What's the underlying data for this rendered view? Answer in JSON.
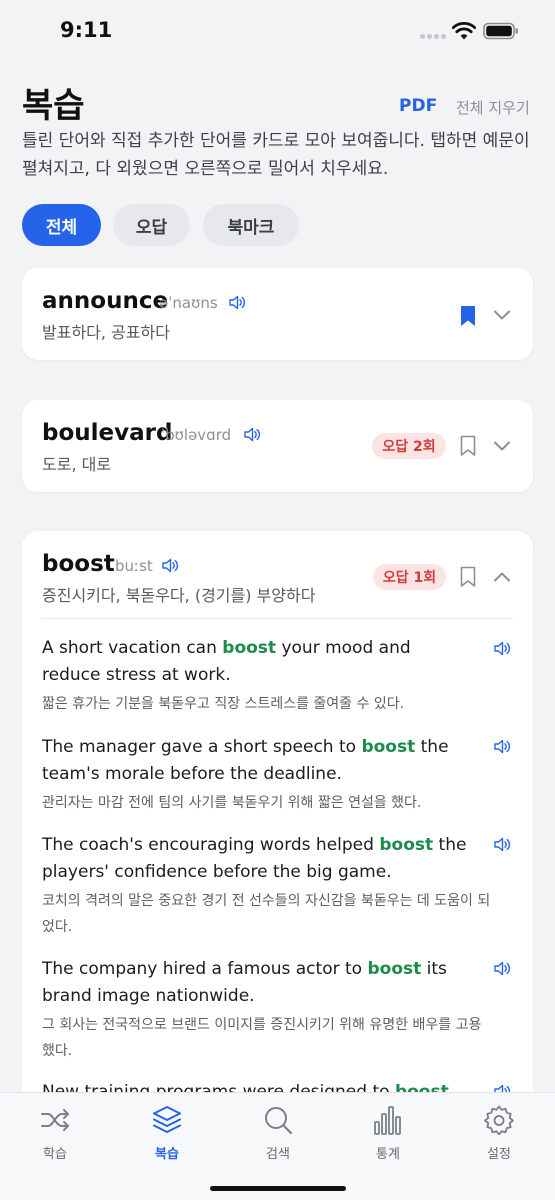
{
  "status_bar": {
    "time": "9:11"
  },
  "header": {
    "title": "복습",
    "pdf_label": "PDF",
    "clear_label": "전체 지우기",
    "description": "틀린 단어와 직접 추가한 단어를 카드로 모아 보여줍니다. 탭하면 예문이 펼쳐지고, 다 외웠으면 오른쪽으로 밀어서 치우세요."
  },
  "filters": [
    {
      "label": "전체",
      "active": true
    },
    {
      "label": "오답",
      "active": false
    },
    {
      "label": "북마크",
      "active": false
    }
  ],
  "cards": [
    {
      "word": "announce",
      "phonetic": "əˈnaʊns",
      "meaning": "발표하다, 공표하다",
      "wrong_badge": "",
      "bookmarked": true,
      "expanded": false
    },
    {
      "word": "boulevard",
      "phonetic": "ˈbʊləvɑrd",
      "meaning": "도로, 대로",
      "wrong_badge": "오답 2회",
      "bookmarked": false,
      "expanded": false
    },
    {
      "word": "boost",
      "phonetic": "buːst",
      "meaning": "증진시키다, 북돋우다, (경기를) 부양하다",
      "wrong_badge": "오답 1회",
      "bookmarked": false,
      "expanded": true,
      "examples": [
        {
          "en_before": "A short vacation can ",
          "highlight": "boost",
          "en_after": " your mood and reduce stress at work.",
          "ko": "짧은 휴가는 기분을 북돋우고 직장 스트레스를 줄여줄 수 있다."
        },
        {
          "en_before": "The manager gave a short speech to ",
          "highlight": "boost",
          "en_after": " the team's morale before the deadline.",
          "ko": "관리자는 마감 전에 팀의 사기를 북돋우기 위해 짧은 연설을 했다."
        },
        {
          "en_before": "The coach's encouraging words helped ",
          "highlight": "boost",
          "en_after": " the players' confidence before the big game.",
          "ko": "코치의 격려의 말은 중요한 경기 전 선수들의 자신감을 북돋우는 데 도움이 되었다."
        },
        {
          "en_before": "The company hired a famous actor to ",
          "highlight": "boost",
          "en_after": " its brand image nationwide.",
          "ko": "그 회사는 전국적으로 브랜드 이미지를 증진시키기 위해 유명한 배우를 고용했다."
        },
        {
          "en_before": "New training programs were designed to ",
          "highlight": "boost",
          "en_after": "",
          "ko": ""
        }
      ]
    }
  ],
  "tab_bar": [
    {
      "label": "학습",
      "icon": "shuffle-icon",
      "active": false
    },
    {
      "label": "복습",
      "icon": "layers-icon",
      "active": true
    },
    {
      "label": "검색",
      "icon": "search-icon",
      "active": false
    },
    {
      "label": "통계",
      "icon": "bar-chart-icon",
      "active": false
    },
    {
      "label": "설정",
      "icon": "gear-icon",
      "active": false
    }
  ],
  "colors": {
    "accent": "#2563eb",
    "highlight": "#1e8a4c",
    "wrong_badge_bg": "#fde4e4",
    "wrong_badge_text": "#d33b3b"
  }
}
